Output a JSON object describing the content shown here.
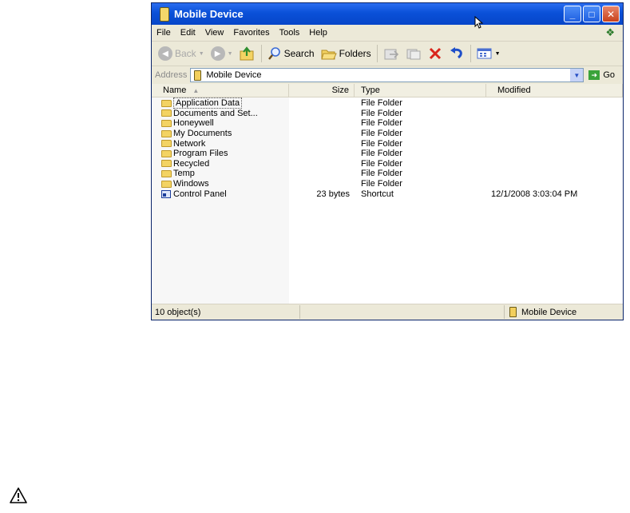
{
  "window": {
    "title": "Mobile Device",
    "caption_buttons": {
      "minimize": "_",
      "maximize": "□",
      "close": "✕"
    }
  },
  "menu": [
    "File",
    "Edit",
    "View",
    "Favorites",
    "Tools",
    "Help"
  ],
  "toolbar": {
    "back_label": "Back",
    "search_label": "Search",
    "folders_label": "Folders"
  },
  "address": {
    "label": "Address",
    "value": "Mobile Device",
    "go_label": "Go"
  },
  "columns": {
    "name": "Name",
    "size": "Size",
    "type": "Type",
    "modified": "Modified"
  },
  "files": [
    {
      "name": "Application Data",
      "size": "",
      "type": "File Folder",
      "modified": "",
      "icon": "folder-icon",
      "selected": true
    },
    {
      "name": "Documents and Set...",
      "size": "",
      "type": "File Folder",
      "modified": "",
      "icon": "folder-icon"
    },
    {
      "name": "Honeywell",
      "size": "",
      "type": "File Folder",
      "modified": "",
      "icon": "folder-icon"
    },
    {
      "name": "My Documents",
      "size": "",
      "type": "File Folder",
      "modified": "",
      "icon": "folder-icon"
    },
    {
      "name": "Network",
      "size": "",
      "type": "File Folder",
      "modified": "",
      "icon": "folder-icon"
    },
    {
      "name": "Program Files",
      "size": "",
      "type": "File Folder",
      "modified": "",
      "icon": "folder-icon"
    },
    {
      "name": "Recycled",
      "size": "",
      "type": "File Folder",
      "modified": "",
      "icon": "folder-icon"
    },
    {
      "name": "Temp",
      "size": "",
      "type": "File Folder",
      "modified": "",
      "icon": "folder-icon"
    },
    {
      "name": "Windows",
      "size": "",
      "type": "File Folder",
      "modified": "",
      "icon": "folder-icon"
    },
    {
      "name": "Control Panel",
      "size": "23 bytes",
      "type": "Shortcut",
      "modified": "12/1/2008  3:03:04 PM",
      "icon": "shortcut-icon"
    }
  ],
  "status": {
    "count": "10 object(s)",
    "location": "Mobile Device"
  },
  "colors": {
    "title_blue": "#0a50d8",
    "chrome": "#ece9d8",
    "close_red": "#c8421c"
  }
}
